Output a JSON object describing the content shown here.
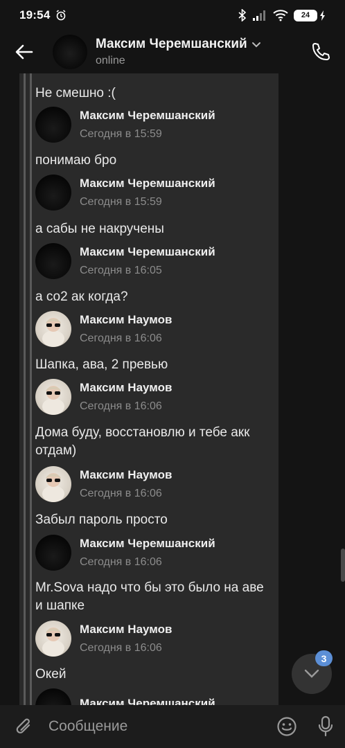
{
  "status_bar": {
    "time": "19:54",
    "battery": "24"
  },
  "header": {
    "name": "Максим Черемшанский",
    "status": "online"
  },
  "messages": [
    {
      "type": "text",
      "text": "Не смешно :("
    },
    {
      "type": "head",
      "author": "Максим Черемшанский",
      "time": "Сегодня в 15:59",
      "avatar": "dark"
    },
    {
      "type": "text",
      "text": "понимаю бро"
    },
    {
      "type": "head",
      "author": "Максим Черемшанский",
      "time": "Сегодня в 15:59",
      "avatar": "dark"
    },
    {
      "type": "text",
      "text": "а сабы не накручены"
    },
    {
      "type": "head",
      "author": "Максим Черемшанский",
      "time": "Сегодня в 16:05",
      "avatar": "dark"
    },
    {
      "type": "text",
      "text": "а со2 ак когда?"
    },
    {
      "type": "head",
      "author": "Максим Наумов",
      "time": "Сегодня в 16:06",
      "avatar": "light"
    },
    {
      "type": "text",
      "text": "Шапка, ава, 2 превью"
    },
    {
      "type": "head",
      "author": "Максим Наумов",
      "time": "Сегодня в 16:06",
      "avatar": "light"
    },
    {
      "type": "text",
      "text": "Дома буду, восстановлю и тебе акк отдам)"
    },
    {
      "type": "head",
      "author": "Максим Наумов",
      "time": "Сегодня в 16:06",
      "avatar": "light"
    },
    {
      "type": "text",
      "text": "Забыл пароль просто"
    },
    {
      "type": "head",
      "author": "Максим Черемшанский",
      "time": "Сегодня в 16:06",
      "avatar": "dark"
    },
    {
      "type": "text",
      "text": "Mr.Sova надо что бы это было на аве и шапке"
    },
    {
      "type": "head",
      "author": "Максим Наумов",
      "time": "Сегодня в 16:06",
      "avatar": "light"
    },
    {
      "type": "text",
      "text": "Окей"
    },
    {
      "type": "head",
      "author": "Максим Черемшанский",
      "time": "",
      "avatar": "dark"
    }
  ],
  "fab": {
    "badge": "3"
  },
  "composer": {
    "placeholder": "Сообщение"
  },
  "colors": {
    "background": "#141414",
    "panel": "#2a2a2a",
    "badge": "#5c8fd6"
  }
}
